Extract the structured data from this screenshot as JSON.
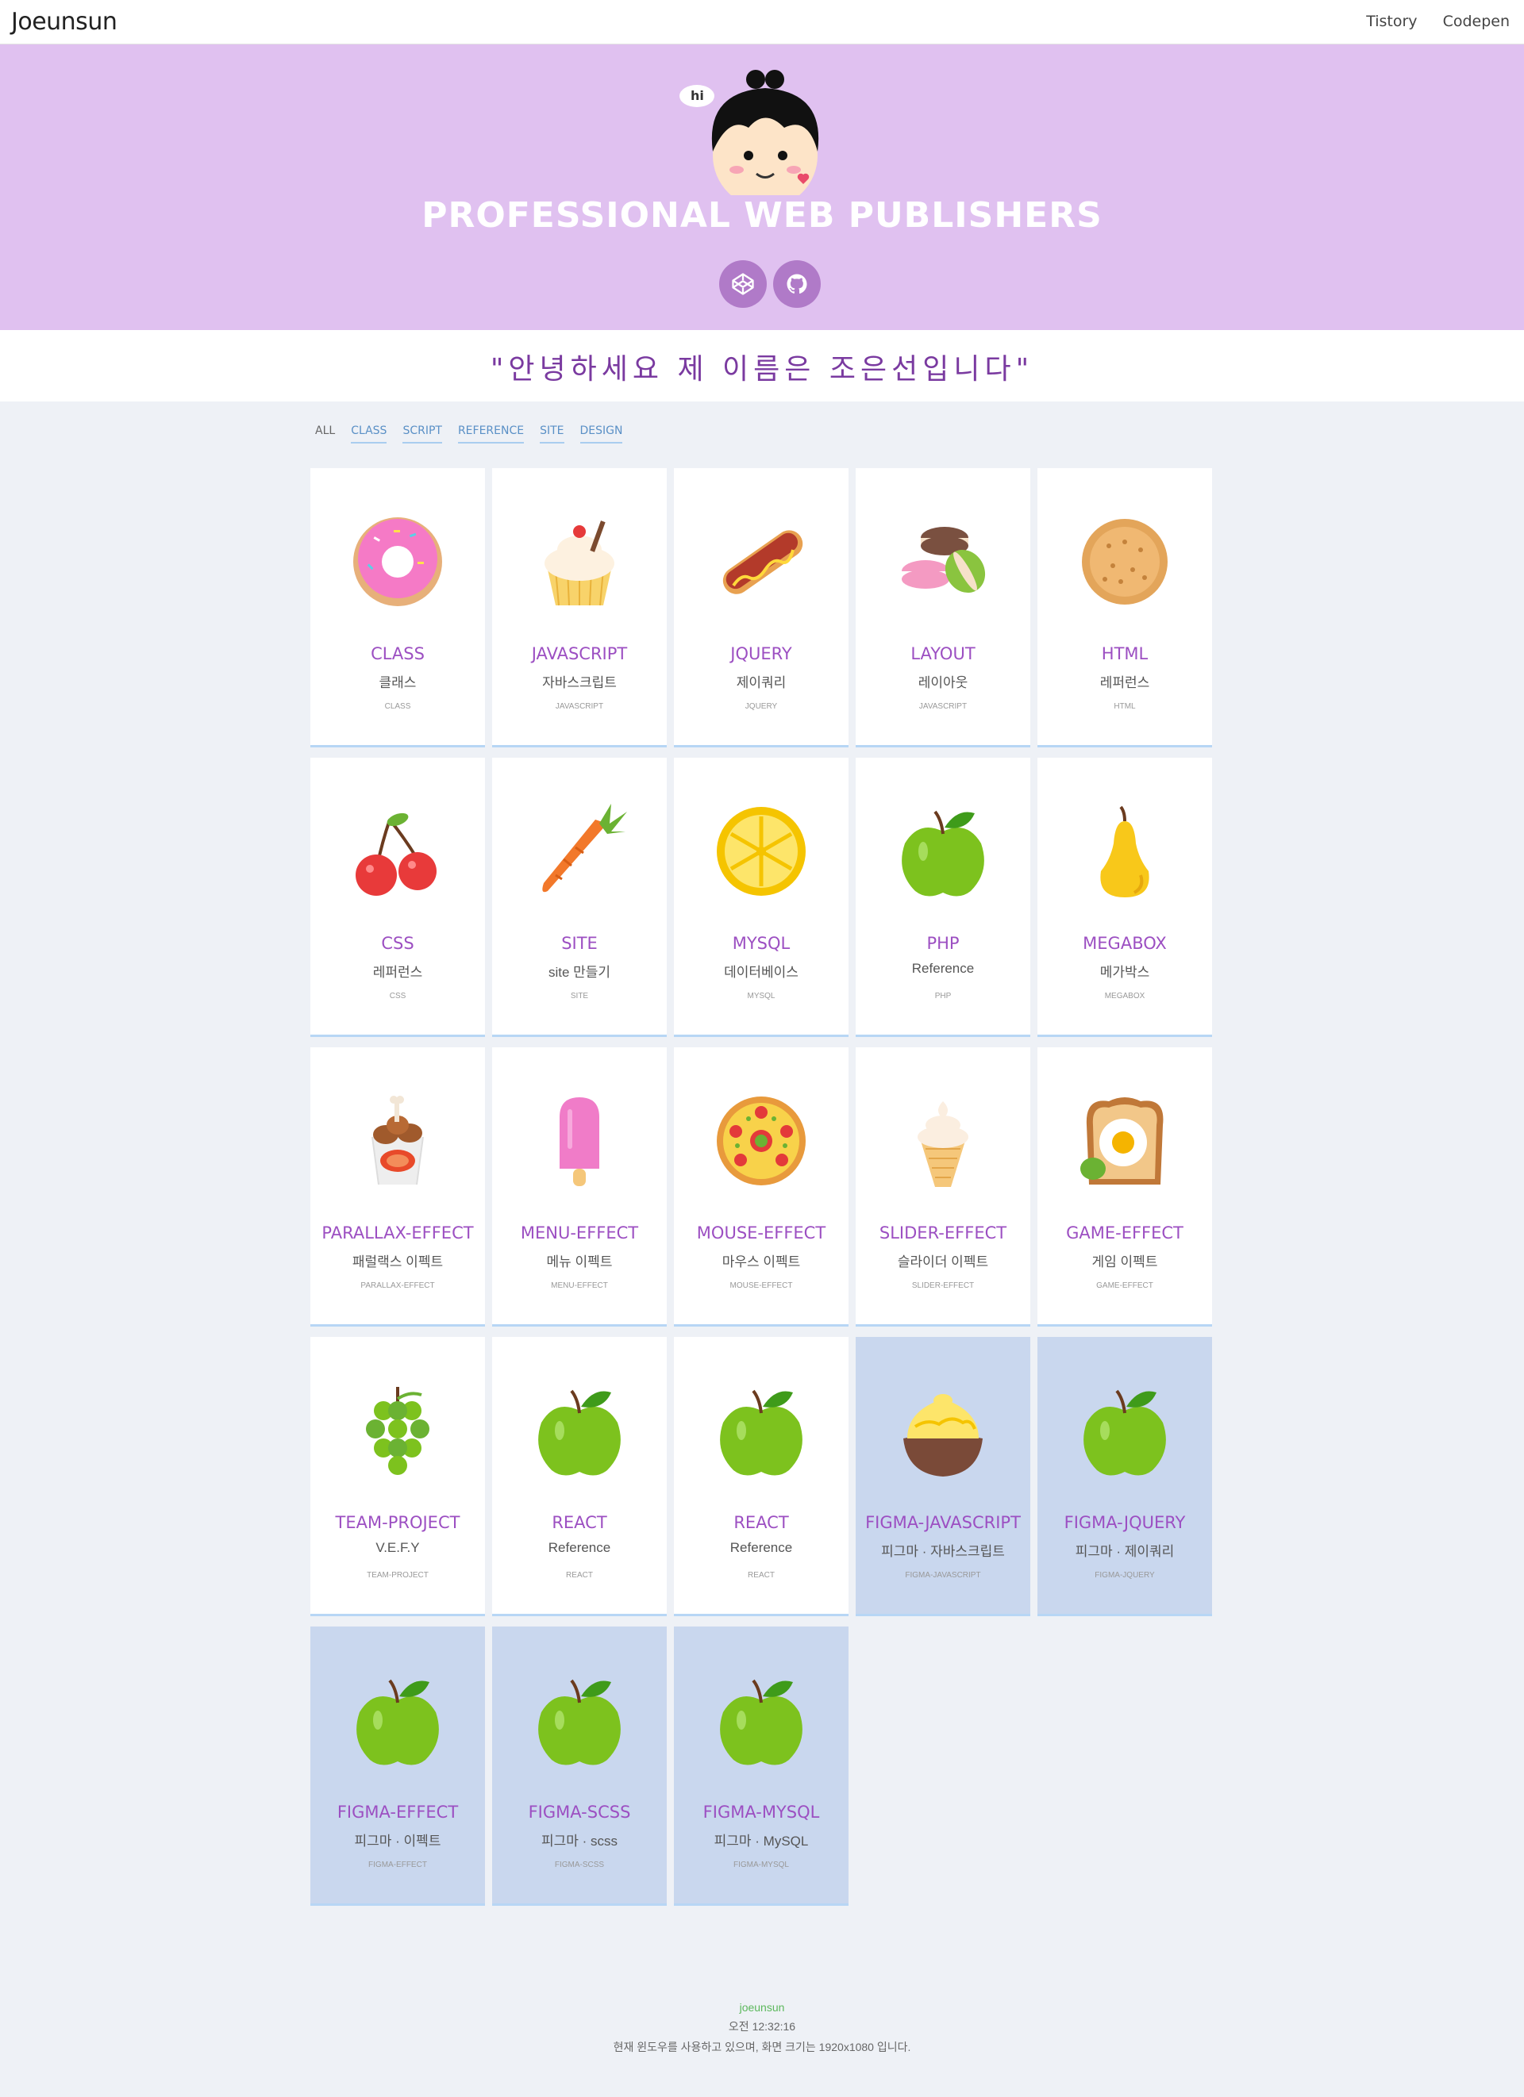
{
  "header": {
    "brand": "Joeunsun",
    "links": [
      "Tistory",
      "Codepen"
    ]
  },
  "hero": {
    "speech": "hi",
    "title": "PROFESSIONAL WEB PUBLISHERS",
    "social": [
      "codepen-icon",
      "github-icon"
    ],
    "colors": {
      "background": "#e0c1f0",
      "button": "#b07ac8"
    }
  },
  "quote": "\"안녕하세요 제 이름은 조은선입니다\"",
  "filters": [
    "ALL",
    "CLASS",
    "SCRIPT",
    "REFERENCE",
    "SITE",
    "DESIGN"
  ],
  "cards": [
    {
      "icon": "donut-icon",
      "title": "CLASS",
      "sub": "클래스",
      "tiny": "CLASS",
      "alt": false
    },
    {
      "icon": "cupcake-icon",
      "title": "JAVASCRIPT",
      "sub": "자바스크립트",
      "tiny": "JAVASCRIPT",
      "alt": false
    },
    {
      "icon": "hotdog-icon",
      "title": "JQUERY",
      "sub": "제이쿼리",
      "tiny": "JQUERY",
      "alt": false
    },
    {
      "icon": "macaron-icon",
      "title": "LAYOUT",
      "sub": "레이아웃",
      "tiny": "JAVASCRIPT",
      "alt": false
    },
    {
      "icon": "cookie-icon",
      "title": "HTML",
      "sub": "레퍼런스",
      "tiny": "HTML",
      "alt": false
    },
    {
      "icon": "cherry-icon",
      "title": "CSS",
      "sub": "레퍼런스",
      "tiny": "CSS",
      "alt": false
    },
    {
      "icon": "carrot-icon",
      "title": "SITE",
      "sub": "site 만들기",
      "tiny": "SITE",
      "alt": false
    },
    {
      "icon": "lemon-icon",
      "title": "MYSQL",
      "sub": "데이터베이스",
      "tiny": "MYSQL",
      "alt": false
    },
    {
      "icon": "apple-icon",
      "title": "PHP",
      "sub": "Reference",
      "tiny": "PHP",
      "alt": false
    },
    {
      "icon": "pear-icon",
      "title": "MEGABOX",
      "sub": "메가박스",
      "tiny": "MEGABOX",
      "alt": false
    },
    {
      "icon": "fried-chicken-icon",
      "title": "PARALLAX-EFFECT",
      "sub": "패럴랙스 이펙트",
      "tiny": "PARALLAX-EFFECT",
      "alt": false
    },
    {
      "icon": "popsicle-icon",
      "title": "MENU-EFFECT",
      "sub": "메뉴 이펙트",
      "tiny": "MENU-EFFECT",
      "alt": false
    },
    {
      "icon": "pizza-icon",
      "title": "MOUSE-EFFECT",
      "sub": "마우스 이펙트",
      "tiny": "MOUSE-EFFECT",
      "alt": false
    },
    {
      "icon": "ice-cream-icon",
      "title": "SLIDER-EFFECT",
      "sub": "슬라이더 이펙트",
      "tiny": "SLIDER-EFFECT",
      "alt": false
    },
    {
      "icon": "toast-egg-icon",
      "title": "GAME-EFFECT",
      "sub": "게임 이펙트",
      "tiny": "GAME-EFFECT",
      "alt": false
    },
    {
      "icon": "grapes-icon",
      "title": "TEAM-PROJECT",
      "sub": "V.E.F.Y",
      "tiny": "TEAM-PROJECT",
      "alt": false
    },
    {
      "icon": "apple-icon",
      "title": "REACT",
      "sub": "Reference",
      "tiny": "REACT",
      "alt": false
    },
    {
      "icon": "apple-icon",
      "title": "REACT",
      "sub": "Reference",
      "tiny": "REACT",
      "alt": false
    },
    {
      "icon": "pudding-icon",
      "title": "FIGMA-JAVASCRIPT",
      "sub": "피그마 · 자바스크립트",
      "tiny": "FIGMA-JAVASCRIPT",
      "alt": true
    },
    {
      "icon": "apple-icon",
      "title": "FIGMA-JQUERY",
      "sub": "피그마 · 제이쿼리",
      "tiny": "FIGMA-JQUERY",
      "alt": true
    },
    {
      "icon": "apple-icon",
      "title": "FIGMA-EFFECT",
      "sub": "피그마 · 이펙트",
      "tiny": "FIGMA-EFFECT",
      "alt": true
    },
    {
      "icon": "apple-icon",
      "title": "FIGMA-SCSS",
      "sub": "피그마 · scss",
      "tiny": "FIGMA-SCSS",
      "alt": true
    },
    {
      "icon": "apple-icon",
      "title": "FIGMA-MYSQL",
      "sub": "피그마 · MySQL",
      "tiny": "FIGMA-MYSQL",
      "alt": true
    }
  ],
  "footer": {
    "name": "joeunsun",
    "time": "오전 12:32:16",
    "info": "현재 윈도우를 사용하고 있으며, 화면 크기는 1920x1080 입니다."
  }
}
